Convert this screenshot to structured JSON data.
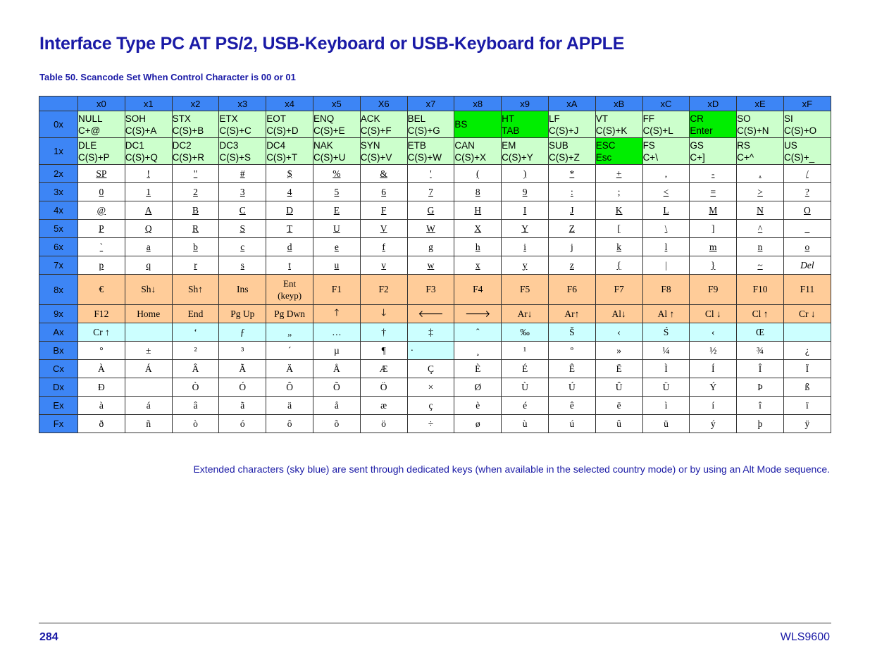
{
  "page": {
    "title": "Interface Type PC AT PS/2, USB-Keyboard or USB-Keyboard for APPLE",
    "table_caption": "Table 50. Scancode Set When Control Character is 00 or 01",
    "note": "Extended characters (sky blue) are sent through dedicated keys (when available in the selected country mode) or by using an Alt Mode sequence.",
    "page_number": "284",
    "product": "WLS9600"
  },
  "colors": {
    "header_blue": "#3d85f5",
    "control_green_light": "#ccffcc",
    "control_green_bright": "#00ee00",
    "function_orange": "#ffcc99",
    "extended_sky_blue": "#ccffff",
    "text_blue": "#1a1aa6"
  },
  "table": {
    "columns": [
      "x0",
      "x1",
      "x2",
      "x3",
      "x4",
      "x5",
      "X6",
      "x7",
      "x8",
      "x9",
      "xA",
      "xB",
      "xC",
      "xD",
      "xE",
      "xF"
    ],
    "rows": [
      {
        "label": "0x",
        "type": "ctl",
        "cells": [
          [
            "NULL",
            "C+@"
          ],
          [
            "SOH",
            "C(S)+A"
          ],
          [
            "STX",
            "C(S)+B"
          ],
          [
            "ETX",
            "C(S)+C"
          ],
          [
            "EOT",
            "C(S)+D"
          ],
          [
            "ENQ",
            "C(S)+E"
          ],
          [
            "ACK",
            "C(S)+F"
          ],
          [
            "BEL",
            "C(S)+G"
          ],
          [
            "BS",
            ""
          ],
          [
            "HT",
            "TAB"
          ],
          [
            "LF",
            "C(S)+J"
          ],
          [
            "VT",
            "C(S)+K"
          ],
          [
            "FF",
            "C(S)+L"
          ],
          [
            "CR",
            "Enter"
          ],
          [
            "SO",
            "C(S)+N"
          ],
          [
            "SI",
            "C(S)+O"
          ]
        ]
      },
      {
        "label": "1x",
        "type": "ctl",
        "cells": [
          [
            "DLE",
            "C(S)+P"
          ],
          [
            "DC1",
            "C(S)+Q"
          ],
          [
            "DC2",
            "C(S)+R"
          ],
          [
            "DC3",
            "C(S)+S"
          ],
          [
            "DC4",
            "C(S)+T"
          ],
          [
            "NAK",
            "C(S)+U"
          ],
          [
            "SYN",
            "C(S)+V"
          ],
          [
            "ETB",
            "C(S)+W"
          ],
          [
            "CAN",
            "C(S)+X"
          ],
          [
            "EM",
            "C(S)+Y"
          ],
          [
            "SUB",
            "C(S)+Z"
          ],
          [
            "ESC",
            "Esc"
          ],
          [
            "FS",
            "C+\\"
          ],
          [
            "GS",
            "C+]"
          ],
          [
            "RS",
            "C+^"
          ],
          [
            "US",
            "C(S)+_"
          ]
        ]
      },
      {
        "label": "2x",
        "type": "chr",
        "cells": [
          "SP",
          "!",
          "\"",
          "#",
          "$",
          "%",
          "&",
          "'",
          "(",
          ")",
          "*",
          "+",
          ",",
          "-",
          ".",
          "/"
        ]
      },
      {
        "label": "3x",
        "type": "chr",
        "cells": [
          "0",
          "1",
          "2",
          "3",
          "4",
          "5",
          "6",
          "7",
          "8",
          "9",
          ":",
          ";",
          "<",
          "=",
          ">",
          "?"
        ]
      },
      {
        "label": "4x",
        "type": "chr",
        "cells": [
          "@",
          "A",
          "B",
          "C",
          "D",
          "E",
          "F",
          "G",
          "H",
          "I",
          "J",
          "K",
          "L",
          "M",
          "N",
          "O"
        ]
      },
      {
        "label": "5x",
        "type": "chr",
        "cells": [
          "P",
          "Q",
          "R",
          "S",
          "T",
          "U",
          "V",
          "W",
          "X",
          "Y",
          "Z",
          "[",
          "\\",
          "]",
          "^",
          "_"
        ]
      },
      {
        "label": "6x",
        "type": "chr",
        "cells": [
          "`",
          "a",
          "b",
          "c",
          "d",
          "e",
          "f",
          "g",
          "h",
          "i",
          "j",
          "k",
          "l",
          "m",
          "n",
          "o"
        ]
      },
      {
        "label": "7x",
        "type": "chr",
        "cells": [
          "p",
          "q",
          "r",
          "s",
          "t",
          "u",
          "v",
          "w",
          "x",
          "y",
          "z",
          "{",
          "|",
          "}",
          "~",
          "Del"
        ]
      },
      {
        "label": "8x",
        "type": "fn",
        "cells": [
          "€",
          "Sh↓",
          "Sh↑",
          "Ins",
          "Ent\n(keyp)",
          "F1",
          "F2",
          "F3",
          "F4",
          "F5",
          "F6",
          "F7",
          "F8",
          "F9",
          "F10",
          "F11"
        ]
      },
      {
        "label": "9x",
        "type": "fn",
        "cells": [
          "F12",
          "Home",
          "End",
          "Pg Up",
          "Pg Dwn",
          "🡑",
          "🡓",
          "🡐",
          "🡒",
          "Ar↓",
          "Ar↑",
          "Al↓",
          "Al ↑",
          "Cl ↓",
          "Cl ↑",
          "Cr ↓"
        ]
      },
      {
        "label": "Ax",
        "type": "ext",
        "cells": [
          "Cr ↑",
          "",
          "‘",
          "ƒ",
          "„",
          "…",
          "†",
          "‡",
          "ˆ",
          "‰",
          "Š",
          "‹",
          "Ś",
          "‹",
          "Œ",
          ""
        ]
      },
      {
        "label": "Bx",
        "type": "ext",
        "cells": [
          "°",
          "±",
          "²",
          "³",
          "´",
          "µ",
          "¶",
          "·",
          "¸",
          "¹",
          "º",
          "»",
          "¼",
          "½",
          "¾",
          "¿"
        ]
      },
      {
        "label": "Cx",
        "type": "ext",
        "cells": [
          "À",
          "Á",
          "Â",
          "Ã",
          "Ä",
          "Å",
          "Æ",
          "Ç",
          "È",
          "É",
          "Ê",
          "Ë",
          "Ì",
          "Í",
          "Î",
          "Ï"
        ]
      },
      {
        "label": "Dx",
        "type": "ext",
        "cells": [
          "Ð",
          "",
          "Ò",
          "Ó",
          "Ô",
          "Õ",
          "Ö",
          "×",
          "Ø",
          "Ù",
          "Ú",
          "Û",
          "Ü",
          "Ý",
          "Þ",
          "ß"
        ]
      },
      {
        "label": "Ex",
        "type": "ext",
        "cells": [
          "à",
          "á",
          "â",
          "ã",
          "ä",
          "å",
          "æ",
          "ç",
          "è",
          "é",
          "ê",
          "ë",
          "ì",
          "í",
          "î",
          "ï"
        ]
      },
      {
        "label": "Fx",
        "type": "ext",
        "cells": [
          "ð",
          "ñ",
          "ò",
          "ó",
          "ô",
          "õ",
          "ö",
          "÷",
          "ø",
          "ù",
          "ú",
          "û",
          "ü",
          "ý",
          "þ",
          "ÿ"
        ]
      }
    ],
    "bright_green_cells": [
      "0x-8",
      "0x-9",
      "0x-13",
      "1x-11"
    ],
    "sky_blue_cells": [
      "Ax-0",
      "Ax-1",
      "Ax-2",
      "Ax-3",
      "Ax-4",
      "Ax-5",
      "Ax-6",
      "Ax-7",
      "Ax-8",
      "Ax-9",
      "Ax-10",
      "Ax-11",
      "Ax-12",
      "Ax-13",
      "Ax-14",
      "Ax-15",
      "Bx-7"
    ],
    "italic_cells": [
      "7x-15"
    ],
    "plain_cells": [
      "Bx-7"
    ]
  }
}
